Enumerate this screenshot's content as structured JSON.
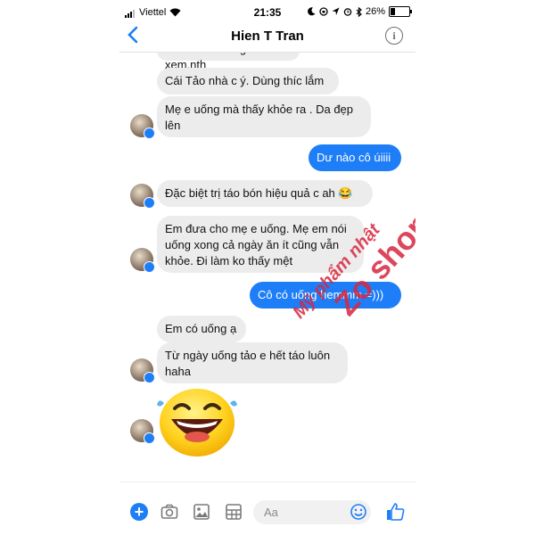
{
  "status_bar": {
    "carrier": "Viettel",
    "time": "21:35",
    "battery": "26%"
  },
  "header": {
    "title": "Hien T Tran",
    "back_icon": "chevron-left-icon",
    "info_icon": "info-icon"
  },
  "messages": [
    {
      "id": "m0",
      "from": "them",
      "text": "Thế nên e dùng thử xem.nth"
    },
    {
      "id": "m1",
      "from": "them",
      "text": "Cái Tảo nhà c ý. Dùng thíc lắm"
    },
    {
      "id": "m2",
      "from": "them",
      "text": "Mẹ e uống mà thấy khỏe ra . Da đẹp lên"
    },
    {
      "id": "m3",
      "from": "me",
      "text": "Dư nào cô úiiii"
    },
    {
      "id": "m4",
      "from": "them",
      "text": "Đặc biệt trị táo bón hiệu quả c ah 😂"
    },
    {
      "id": "m5",
      "from": "them",
      "text": "Em đưa cho mẹ e uống. Mẹ em nói uống xong cả ngày ăn ít cũng vẫn khỏe. Đi làm ko thấy mệt"
    },
    {
      "id": "m6",
      "from": "me",
      "text": "Cô có uống hemmm =)))"
    },
    {
      "id": "m7",
      "from": "them",
      "text": "Em có uống ạ"
    },
    {
      "id": "m8",
      "from": "them",
      "text": "Từ ngày uống tảo e hết táo luôn haha"
    },
    {
      "id": "m9",
      "from": "them",
      "text": "",
      "sticker": "laughing-tears-emoji"
    }
  ],
  "watermark": {
    "line1": "Mỹ phẩm nhật",
    "line2": "Zo shop"
  },
  "input_bar": {
    "placeholder": "Aa",
    "icons": [
      "plus-icon",
      "camera-icon",
      "gallery-icon",
      "grid-icon",
      "emoji-icon",
      "thumbs-up-icon"
    ]
  },
  "colors": {
    "accent": "#1e7ef7",
    "incoming_bubble": "#ececec",
    "watermark": "#d7283f"
  }
}
